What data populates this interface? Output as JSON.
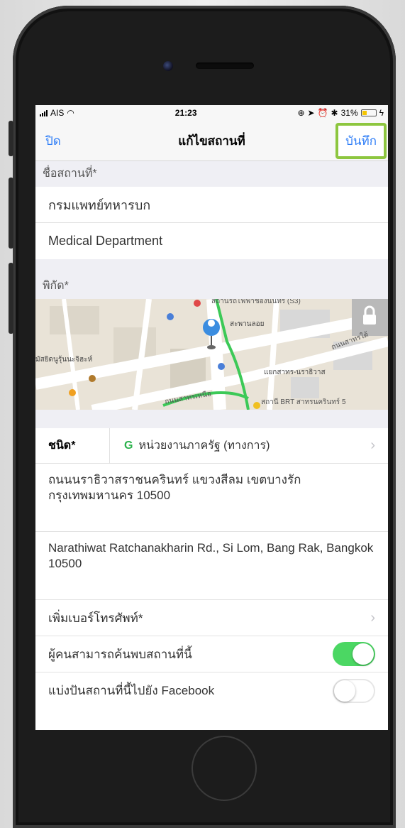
{
  "status_bar": {
    "carrier": "AIS",
    "time": "21:23",
    "battery": "31%",
    "battery_level": 0.31
  },
  "nav": {
    "close_label": "ปิด",
    "title": "แก้ไขสถานที่",
    "save_label": "บันทึก"
  },
  "place_name": {
    "header": "ชื่อสถานที่*",
    "thai_name": "กรมแพทย์ทหารบก",
    "english_name": "Medical Department"
  },
  "coordinates": {
    "header": "พิกัด*",
    "map_labels": {
      "top": "สถานีรถไฟฟ้าช่องนนทรี (S3)",
      "sapan_loy": "สะพานลอย",
      "left": "มัสยิดนูรุ้นนะจิฮะห์",
      "road_south": "ถนนสาทรใต้",
      "road_north": "ถนนสาทรเหนือ",
      "junction": "แยกสาทร-นราธิวาส",
      "brt": "สถานี BRT สาทรนครินทร์ 5"
    }
  },
  "type": {
    "label": "ชนิด*",
    "icon_letter": "G",
    "value": "หน่วยงานภาครัฐ (ทางการ)"
  },
  "address_thai": "ถนนนราธิวาสราชนครินทร์ แขวงสีลม เขตบางรัก กรุงเทพมหานคร 10500",
  "address_english": "Narathiwat Ratchanakharin Rd., Si Lom, Bang Rak, Bangkok 10500",
  "add_phone_label": "เพิ่มเบอร์โทรศัพท์*",
  "discoverable": {
    "label": "ผู้คนสามารถค้นพบสถานที่นี้",
    "on": true
  },
  "share_facebook": {
    "label": "แบ่งปันสถานที่นี้ไปยัง Facebook",
    "on": false
  },
  "colors": {
    "accent": "#2f7ef7",
    "highlight": "#8dc63f",
    "switch_on": "#4bd763"
  }
}
